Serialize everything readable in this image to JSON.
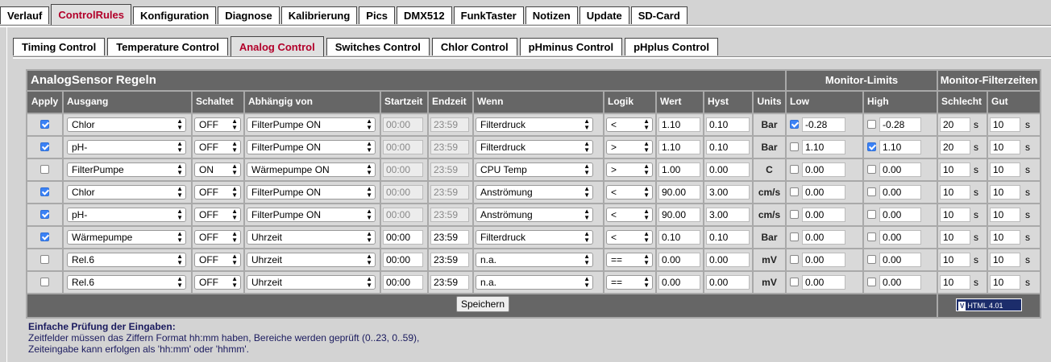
{
  "tabs": [
    "Verlauf",
    "ControlRules",
    "Konfiguration",
    "Diagnose",
    "Kalibrierung",
    "Pics",
    "DMX512",
    "FunkTaster",
    "Notizen",
    "Update",
    "SD-Card"
  ],
  "active_tab": "ControlRules",
  "subtabs": [
    "Timing Control",
    "Temperature Control",
    "Analog Control",
    "Switches Control",
    "Chlor Control",
    "pHminus Control",
    "pHplus Control"
  ],
  "active_subtab": "Analog Control",
  "table": {
    "title": "AnalogSensor Regeln",
    "monitor_limits": "Monitor-Limits",
    "monitor_filter": "Monitor-Filterzeiten",
    "columns": {
      "apply": "Apply",
      "ausgang": "Ausgang",
      "schaltet": "Schaltet",
      "abhaengig": "Abhängig von",
      "startzeit": "Startzeit",
      "endzeit": "Endzeit",
      "wenn": "Wenn",
      "logik": "Logik",
      "wert": "Wert",
      "hyst": "Hyst",
      "units": "Units",
      "low": "Low",
      "high": "High",
      "schlecht": "Schlecht",
      "gut": "Gut"
    },
    "sec_unit": "s",
    "rows": [
      {
        "apply": true,
        "ausgang": "Chlor",
        "schaltet": "OFF",
        "abhaengig": "FilterPumpe ON",
        "start": "00:00",
        "end": "23:59",
        "time_disabled": true,
        "wenn": "Filterdruck",
        "logik": "<",
        "wert": "1.10",
        "hyst": "0.10",
        "unit": "Bar",
        "low_on": true,
        "low": "-0.28",
        "high_on": false,
        "high": "-0.28",
        "schlecht": "20",
        "gut": "10"
      },
      {
        "apply": true,
        "ausgang": "pH-",
        "schaltet": "OFF",
        "abhaengig": "FilterPumpe ON",
        "start": "00:00",
        "end": "23:59",
        "time_disabled": true,
        "wenn": "Filterdruck",
        "logik": ">",
        "wert": "1.10",
        "hyst": "0.10",
        "unit": "Bar",
        "low_on": false,
        "low": "1.10",
        "high_on": true,
        "high": "1.10",
        "schlecht": "20",
        "gut": "10"
      },
      {
        "apply": false,
        "ausgang": "FilterPumpe",
        "schaltet": "ON",
        "abhaengig": "Wärmepumpe ON",
        "start": "00:00",
        "end": "23:59",
        "time_disabled": true,
        "wenn": "CPU Temp",
        "logik": ">",
        "wert": "1.00",
        "hyst": "0.00",
        "unit": "C",
        "low_on": false,
        "low": "0.00",
        "high_on": false,
        "high": "0.00",
        "schlecht": "10",
        "gut": "10"
      },
      {
        "apply": true,
        "ausgang": "Chlor",
        "schaltet": "OFF",
        "abhaengig": "FilterPumpe ON",
        "start": "00:00",
        "end": "23:59",
        "time_disabled": true,
        "wenn": "Anströmung",
        "logik": "<",
        "wert": "90.00",
        "hyst": "3.00",
        "unit": "cm/s",
        "low_on": false,
        "low": "0.00",
        "high_on": false,
        "high": "0.00",
        "schlecht": "10",
        "gut": "10"
      },
      {
        "apply": true,
        "ausgang": "pH-",
        "schaltet": "OFF",
        "abhaengig": "FilterPumpe ON",
        "start": "00:00",
        "end": "23:59",
        "time_disabled": true,
        "wenn": "Anströmung",
        "logik": "<",
        "wert": "90.00",
        "hyst": "3.00",
        "unit": "cm/s",
        "low_on": false,
        "low": "0.00",
        "high_on": false,
        "high": "0.00",
        "schlecht": "10",
        "gut": "10"
      },
      {
        "apply": true,
        "ausgang": "Wärmepumpe",
        "schaltet": "OFF",
        "abhaengig": "Uhrzeit",
        "start": "00:00",
        "end": "23:59",
        "time_disabled": false,
        "wenn": "Filterdruck",
        "logik": "<",
        "wert": "0.10",
        "hyst": "0.10",
        "unit": "Bar",
        "low_on": false,
        "low": "0.00",
        "high_on": false,
        "high": "0.00",
        "schlecht": "10",
        "gut": "10"
      },
      {
        "apply": false,
        "ausgang": "Rel.6",
        "schaltet": "OFF",
        "abhaengig": "Uhrzeit",
        "start": "00:00",
        "end": "23:59",
        "time_disabled": false,
        "wenn": "n.a.",
        "logik": "==",
        "wert": "0.00",
        "hyst": "0.00",
        "unit": "mV",
        "low_on": false,
        "low": "0.00",
        "high_on": false,
        "high": "0.00",
        "schlecht": "10",
        "gut": "10"
      },
      {
        "apply": false,
        "ausgang": "Rel.6",
        "schaltet": "OFF",
        "abhaengig": "Uhrzeit",
        "start": "00:00",
        "end": "23:59",
        "time_disabled": false,
        "wenn": "n.a.",
        "logik": "==",
        "wert": "0.00",
        "hyst": "0.00",
        "unit": "mV",
        "low_on": false,
        "low": "0.00",
        "high_on": false,
        "high": "0.00",
        "schlecht": "10",
        "gut": "10"
      }
    ],
    "save_label": "Speichern",
    "validator_label": "HTML 4.01",
    "validator_mark": "V"
  },
  "notes": {
    "heading": "Einfache Prüfung der Eingaben:",
    "line1": "Zeitfelder müssen das Ziffern Format hh:mm haben, Bereiche werden geprüft (0..23, 0..59),",
    "line2": "Zeiteingabe kann erfolgen als 'hh:mm' oder 'hhmm'."
  },
  "colors": {
    "active_tab_text": "#b2002a",
    "header_bg": "#666666",
    "checkbox_on": "#3b82f6",
    "note_text": "#1a1a5e"
  }
}
